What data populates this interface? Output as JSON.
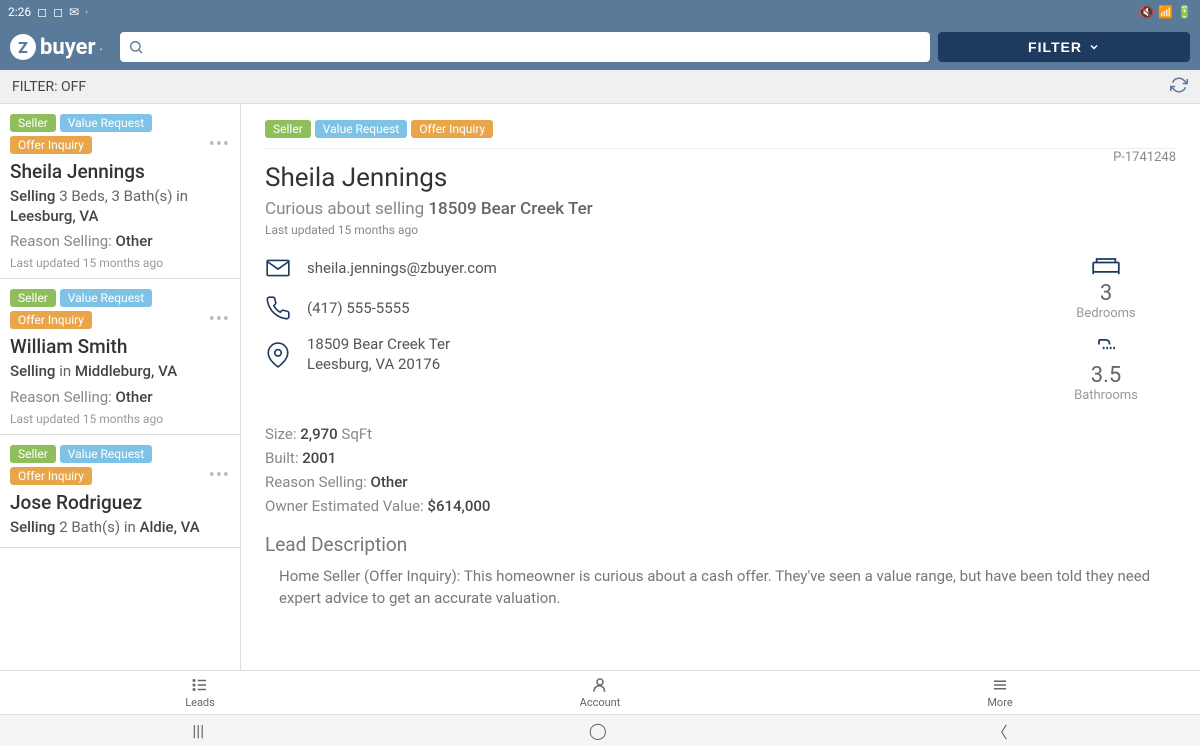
{
  "status_bar": {
    "time": "2:26"
  },
  "header": {
    "logo_text": "buyer",
    "filter_button": "FILTER"
  },
  "filter_bar": {
    "label": "FILTER:",
    "state": "OFF"
  },
  "leads": [
    {
      "tags": [
        "Seller",
        "Value Request",
        "Offer Inquiry"
      ],
      "name": "Sheila Jennings",
      "selling_prefix": "Selling",
      "selling_text": "3 Beds, 3 Bath(s) in",
      "location": "Leesburg, VA",
      "reason_label": "Reason Selling:",
      "reason_value": "Other",
      "updated": "Last updated 15 months ago"
    },
    {
      "tags": [
        "Seller",
        "Value Request",
        "Offer Inquiry"
      ],
      "name": "William Smith",
      "selling_prefix": "Selling",
      "selling_text": "in",
      "location": "Middleburg, VA",
      "reason_label": "Reason Selling:",
      "reason_value": "Other",
      "updated": "Last updated 15 months ago"
    },
    {
      "tags": [
        "Seller",
        "Value Request",
        "Offer Inquiry"
      ],
      "name": "Jose Rodriguez",
      "selling_prefix": "Selling",
      "selling_text": "2 Bath(s) in",
      "location": "Aldie, VA",
      "reason_label": "Reason Selling:",
      "reason_value": "Other",
      "updated": "Last updated 15 months ago"
    }
  ],
  "detail": {
    "id": "P-1741248",
    "tags": [
      "Seller",
      "Value Request",
      "Offer Inquiry"
    ],
    "name": "Sheila Jennings",
    "subtitle_prefix": "Curious about selling",
    "subtitle_address": "18509 Bear Creek Ter",
    "updated": "Last updated 15 months ago",
    "email": "sheila.jennings@zbuyer.com",
    "phone": "(417) 555-5555",
    "address_line1": "18509 Bear Creek Ter",
    "address_line2": "Leesburg, VA 20176",
    "bedrooms_value": "3",
    "bedrooms_label": "Bedrooms",
    "bathrooms_value": "3.5",
    "bathrooms_label": "Bathrooms",
    "size_label": "Size:",
    "size_value": "2,970",
    "size_unit": "SqFt",
    "built_label": "Built:",
    "built_value": "2001",
    "reason_label": "Reason Selling:",
    "reason_value": "Other",
    "owner_est_label": "Owner Estimated Value:",
    "owner_est_value": "$614,000",
    "desc_title": "Lead Description",
    "desc_text": "Home Seller (Offer Inquiry): This homeowner is curious about a cash offer. They've seen a value range, but have been told they need expert advice to get an accurate valuation."
  },
  "bottom_nav": {
    "leads": "Leads",
    "account": "Account",
    "more": "More"
  }
}
